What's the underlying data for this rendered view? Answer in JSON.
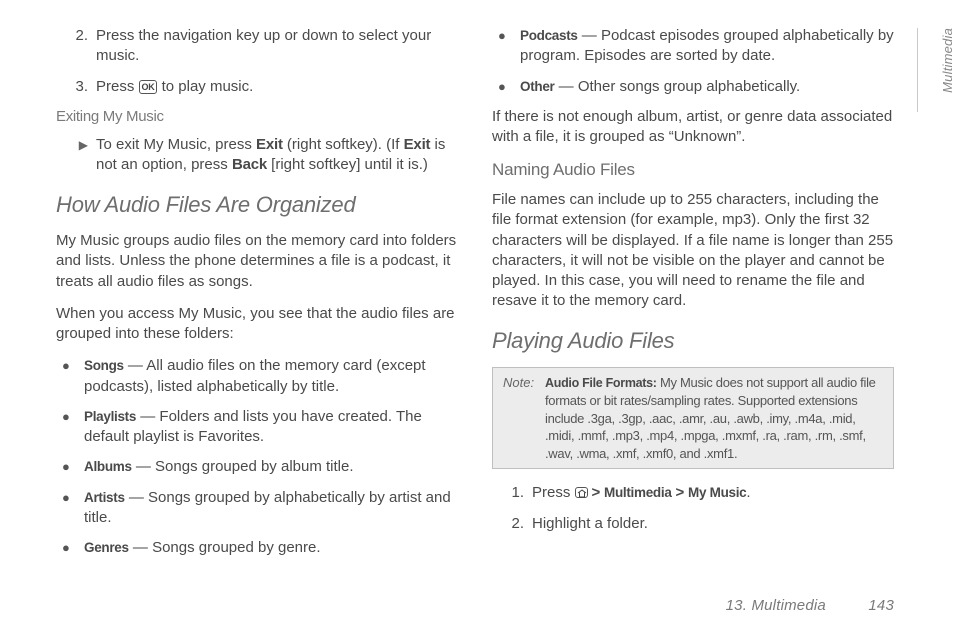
{
  "sideTab": "Multimedia",
  "footer": {
    "chapter": "13. Multimedia",
    "page": "143"
  },
  "left": {
    "steps": [
      {
        "num": "2.",
        "text": "Press the navigation key up or down to select your music."
      },
      {
        "num": "3.",
        "pre": "Press ",
        "key": "OK",
        "post": " to play music."
      }
    ],
    "exitHead": "Exiting My Music",
    "exit": {
      "pre": "To exit My Music, press ",
      "b1": "Exit",
      "mid1": " (right softkey). (If ",
      "b2": "Exit",
      "mid2": " is not an option, press ",
      "b3": "Back",
      "post": " [right softkey] until it is.)"
    },
    "h2": "How Audio Files Are Organized",
    "p1": "My Music groups audio files on the memory card into folders and lists. Unless the phone determines a file is a podcast, it treats all audio files as songs.",
    "p2": "When you access My Music, you see that the audio files are grouped into these folders:",
    "folders": [
      {
        "b": "Songs",
        "t": " — All audio files on the memory card (except podcasts), listed alphabetically by title."
      },
      {
        "b": "Playlists",
        "t": " — Folders and lists you have created. The default playlist is Favorites."
      },
      {
        "b": "Albums",
        "t": " — Songs grouped by album title."
      },
      {
        "b": "Artists",
        "t": " — Songs grouped by alphabetically by artist and title."
      },
      {
        "b": "Genres",
        "t": " — Songs grouped by genre."
      }
    ]
  },
  "right": {
    "foldersCont": [
      {
        "b": "Podcasts",
        "t": " — Podcast episodes grouped alphabetically by program. Episodes are sorted by date."
      },
      {
        "b": "Other",
        "t": " — Other songs group alphabetically."
      }
    ],
    "p3": "If there is not enough album, artist, or genre data associated with a file, it is grouped as “Unknown”.",
    "namingHead": "Naming Audio Files",
    "p4": "File names can include up to 255 characters, including the file format extension (for example, mp3). Only the first 32 characters will be displayed. If a file name is longer than 255 characters, it will not be visible on the player and cannot be played. In this case, you will need to rename the file and resave it to the memory card.",
    "h2b": "Playing Audio Files",
    "note": {
      "label": "Note:",
      "b": "Audio File Formats:",
      "t": " My Music does not support all audio file formats or bit rates/sampling rates. Supported extensions include .3ga, .3gp, .aac, .amr, .au, .awb, .imy, .m4a, .mid, .midi, .mmf, .mp3, .mp4, .mpga, .mxmf, .ra, .ram, .rm, .smf, .wav, .wma, .xmf, .xmf0, and .xmf1."
    },
    "steps2": [
      {
        "num": "1.",
        "pre": "Press ",
        "b1": "Multimedia",
        "gt": " > ",
        "b2": "My Music",
        "post": "."
      },
      {
        "num": "2.",
        "text": "Highlight a folder."
      }
    ]
  }
}
